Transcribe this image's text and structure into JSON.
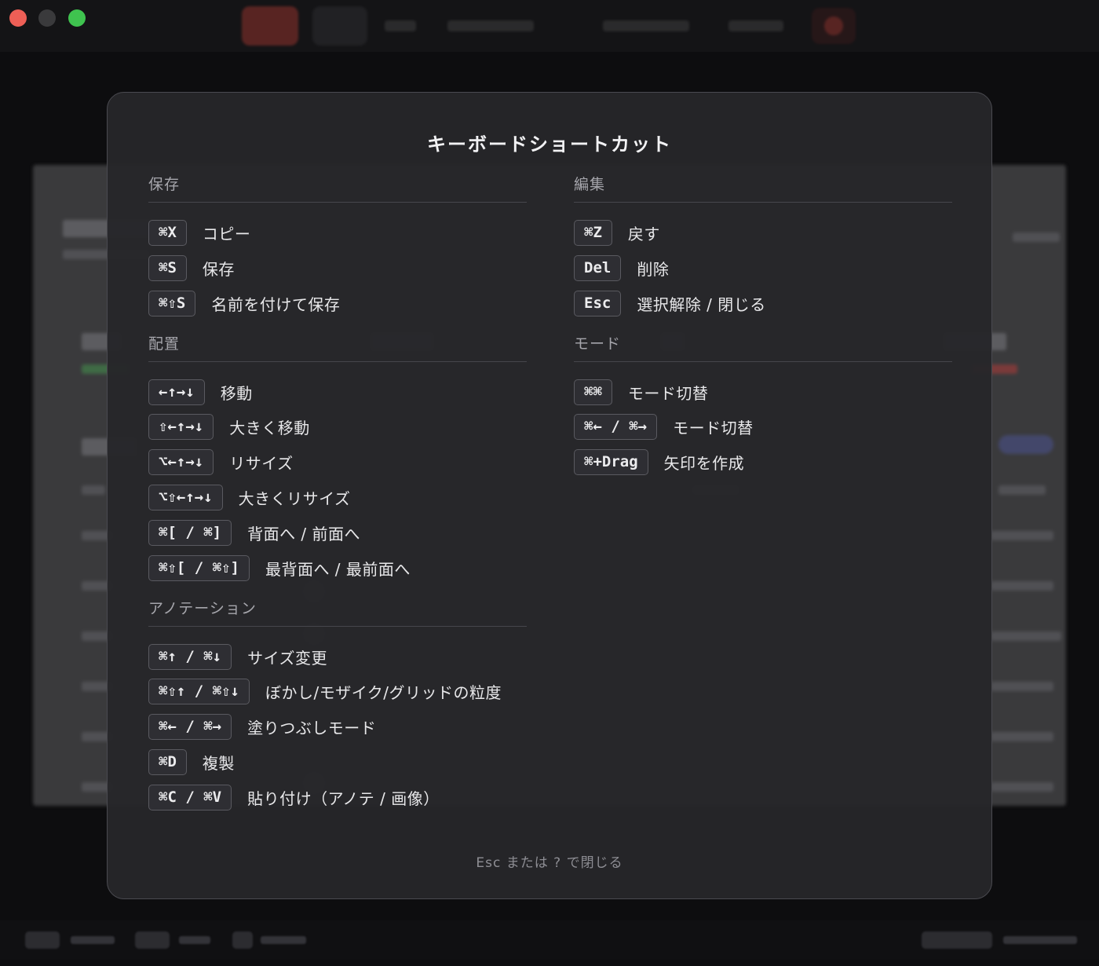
{
  "modal": {
    "title": "キーボードショートカット",
    "footer": "Esc または ? で閉じる",
    "left_sections": [
      {
        "title": "保存",
        "items": [
          {
            "key": "⌘X",
            "desc": "コピー"
          },
          {
            "key": "⌘S",
            "desc": "保存"
          },
          {
            "key": "⌘⇧S",
            "desc": "名前を付けて保存"
          }
        ]
      },
      {
        "title": "配置",
        "items": [
          {
            "key": "←↑→↓",
            "desc": "移動"
          },
          {
            "key": "⇧←↑→↓",
            "desc": "大きく移動"
          },
          {
            "key": "⌥←↑→↓",
            "desc": "リサイズ"
          },
          {
            "key": "⌥⇧←↑→↓",
            "desc": "大きくリサイズ"
          },
          {
            "key": "⌘[ / ⌘]",
            "desc": "背面へ / 前面へ"
          },
          {
            "key": "⌘⇧[ / ⌘⇧]",
            "desc": "最背面へ / 最前面へ"
          }
        ]
      },
      {
        "title": "アノテーション",
        "items": [
          {
            "key": "⌘↑ / ⌘↓",
            "desc": "サイズ変更"
          },
          {
            "key": "⌘⇧↑ / ⌘⇧↓",
            "desc": "ぼかし/モザイク/グリッドの粒度"
          },
          {
            "key": "⌘← / ⌘→",
            "desc": "塗りつぶしモード"
          },
          {
            "key": "⌘D",
            "desc": "複製"
          },
          {
            "key": "⌘C / ⌘V",
            "desc": "貼り付け（アノテ / 画像）"
          }
        ]
      }
    ],
    "right_sections": [
      {
        "title": "編集",
        "items": [
          {
            "key": "⌘Z",
            "desc": "戻す"
          },
          {
            "key": "Del",
            "desc": "削除"
          },
          {
            "key": "Esc",
            "desc": "選択解除 / 閉じる"
          }
        ]
      },
      {
        "title": "モード",
        "items": [
          {
            "key": "⌘⌘",
            "desc": "モード切替"
          },
          {
            "key": "⌘← / ⌘→",
            "desc": "モード切替"
          },
          {
            "key": "⌘+Drag",
            "desc": "矢印を作成"
          }
        ]
      }
    ]
  },
  "colors": {
    "modal_bg": "#26262a",
    "key_bg": "#2e2e33",
    "record_red": "#d8443a",
    "close_red": "#ee5f56",
    "zoom_green": "#3fc34f"
  }
}
